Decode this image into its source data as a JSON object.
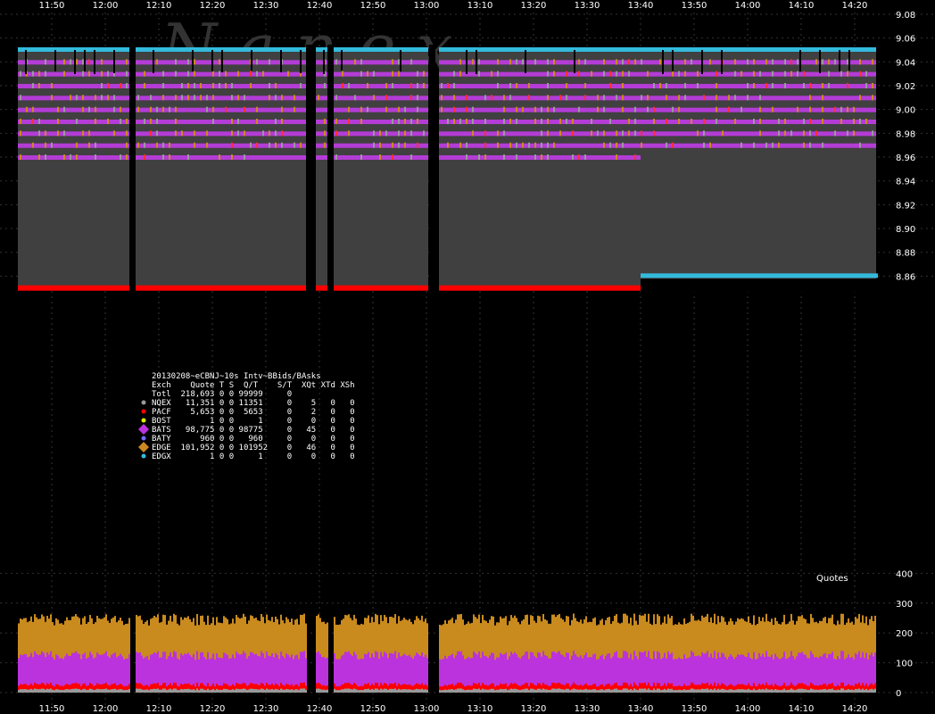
{
  "watermark": "N a n e x",
  "chart_data": [
    {
      "type": "line",
      "title": "20130208~eCBNJ~10s Intv~BBids/BAsks",
      "x_ticks": [
        "11:50",
        "12:00",
        "12:10",
        "12:20",
        "12:30",
        "12:40",
        "12:50",
        "13:00",
        "13:10",
        "13:20",
        "13:30",
        "13:40",
        "13:50",
        "14:00",
        "14:10",
        "14:20"
      ],
      "y_ticks": [
        "9.08",
        "9.06",
        "9.04",
        "9.02",
        "9.00",
        "8.98",
        "8.96",
        "8.94",
        "8.92",
        "8.90",
        "8.88",
        "8.86"
      ],
      "ylim": [
        8.845,
        9.08
      ],
      "price_levels": [
        9.05,
        9.04,
        9.03,
        9.02,
        9.01,
        9.0,
        8.99,
        8.98,
        8.97,
        8.96
      ],
      "best_ask": [
        {
          "from": "11:45",
          "to": "13:40",
          "price": 9.05
        },
        {
          "from": "13:40",
          "to": "14:26",
          "price": 9.05
        },
        {
          "from": "13:40",
          "to": "14:26",
          "price": 8.86
        }
      ],
      "best_bid": [
        {
          "from": "11:45",
          "to": "13:40",
          "price": 8.85
        }
      ],
      "gaps": [
        "12:05",
        "12:38",
        "12:42",
        "13:01"
      ],
      "legend": [
        {
          "name": "Totl",
          "color": "#ffffff"
        },
        {
          "name": "NQEX",
          "color": "#999999"
        },
        {
          "name": "PACF",
          "color": "#ff0000"
        },
        {
          "name": "BOST",
          "color": "#ddee00"
        },
        {
          "name": "BATS",
          "color": "#bb33dd"
        },
        {
          "name": "BATY",
          "color": "#7766ff"
        },
        {
          "name": "EDGE",
          "color": "#cc8822"
        },
        {
          "name": "EDGX",
          "color": "#33bbdd"
        }
      ]
    },
    {
      "type": "area",
      "title": "Quotes",
      "y_ticks": [
        "400",
        "300",
        "200",
        "100",
        "0"
      ],
      "ylim": [
        0,
        400
      ],
      "series": [
        {
          "name": "EDGE",
          "color": "#c98a1e",
          "approx_top": 240
        },
        {
          "name": "BATS",
          "color": "#bb33dd",
          "approx_top": 120
        },
        {
          "name": "PACF",
          "color": "#ff0000",
          "approx_top": 20
        },
        {
          "name": "NQEX",
          "color": "#999999",
          "approx_top": 8
        }
      ]
    }
  ],
  "stats": {
    "header": "20130208~eCBNJ~10s Intv~BBids/BAsks",
    "columns": "Exch    Quote T S  Q/T    S/T  XQt XTd XSh",
    "rows": [
      {
        "line": "Totl  218,693 0 0 99999     0",
        "marker": "none",
        "color": "#ffffff"
      },
      {
        "line": "NQEX   11,351 0 0 11351     0    5   0   0",
        "marker": "dot",
        "color": "#999999"
      },
      {
        "line": "PACF    5,653 0 0  5653     0    2   0   0",
        "marker": "dot",
        "color": "#ff0000"
      },
      {
        "line": "BOST        1 0 0     1     0    0   0   0",
        "marker": "dot",
        "color": "#ddee00"
      },
      {
        "line": "BATS   98,775 0 0 98775     0   45   0   0",
        "marker": "diamond",
        "color": "#bb33dd"
      },
      {
        "line": "BATY      960 0 0   960     0    0   0   0",
        "marker": "dot",
        "color": "#7766ff"
      },
      {
        "line": "EDGE  101,952 0 0 101952    0   46   0   0",
        "marker": "diamond",
        "color": "#cc8822"
      },
      {
        "line": "EDGX        1 0 0     1     0    0   0   0",
        "marker": "dot",
        "color": "#33bbdd"
      }
    ]
  }
}
